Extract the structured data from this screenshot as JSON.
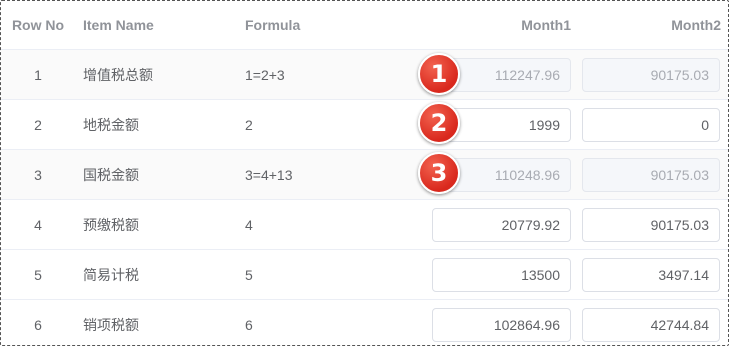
{
  "header": {
    "row_no": "Row No",
    "item_name": "Item Name",
    "formula": "Formula",
    "month1": "Month1",
    "month2": "Month2"
  },
  "rows": [
    {
      "no": "1",
      "name": "增值税总额",
      "formula": "1=2+3",
      "month1": "112247.96",
      "month2": "90175.03",
      "editable": false
    },
    {
      "no": "2",
      "name": "地税金额",
      "formula": "2",
      "month1": "1999",
      "month2": "0",
      "editable": true
    },
    {
      "no": "3",
      "name": "国税金额",
      "formula": "3=4+13",
      "month1": "110248.96",
      "month2": "90175.03",
      "editable": false
    },
    {
      "no": "4",
      "name": "预缴税额",
      "formula": "4",
      "month1": "20779.92",
      "month2": "90175.03",
      "editable": true
    },
    {
      "no": "5",
      "name": "简易计税",
      "formula": "5",
      "month1": "13500",
      "month2": "3497.14",
      "editable": true
    },
    {
      "no": "6",
      "name": "销项税额",
      "formula": "6",
      "month1": "102864.96",
      "month2": "42744.84",
      "editable": true
    }
  ],
  "badges": [
    "1",
    "2",
    "3"
  ],
  "colors": {
    "badge": "#e0392b",
    "header_text": "#909399",
    "body_text": "#606266",
    "disabled_bg": "#f5f7fa",
    "border": "#dcdfe6"
  }
}
